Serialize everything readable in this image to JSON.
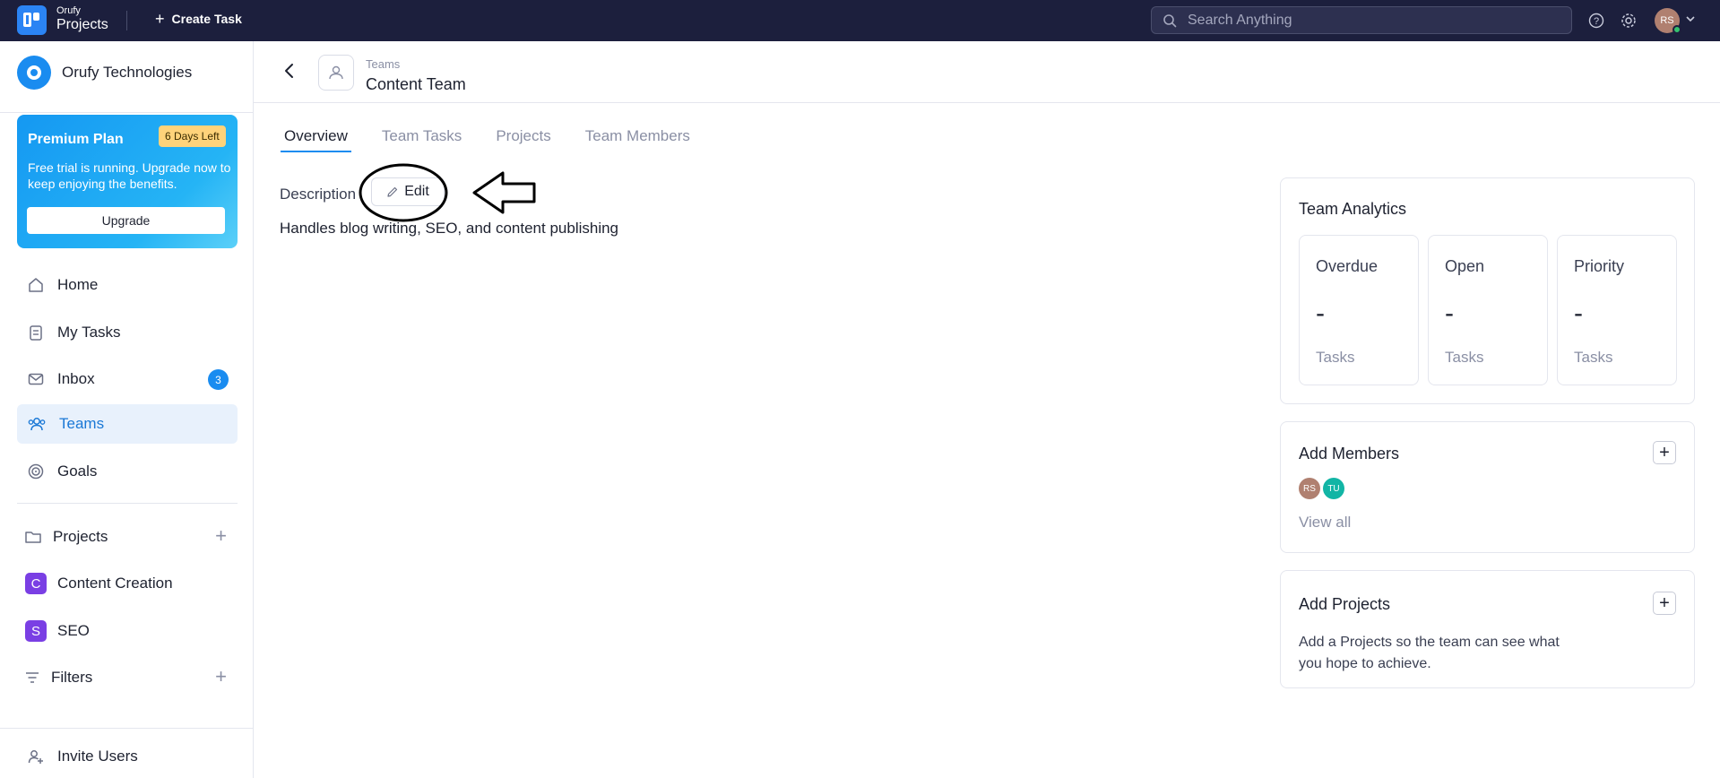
{
  "topbar": {
    "brand_small": "Orufy",
    "brand_big": "Projects",
    "create_task_label": "Create Task",
    "search_placeholder": "Search Anything",
    "user_initials": "RS"
  },
  "sidebar": {
    "org_name": "Orufy Technologies",
    "plan": {
      "title": "Premium Plan",
      "badge": "6 Days Left",
      "description": "Free trial is running. Upgrade now to keep enjoying the benefits.",
      "button": "Upgrade"
    },
    "nav": [
      {
        "label": "Home",
        "icon": "home-icon"
      },
      {
        "label": "My Tasks",
        "icon": "clipboard-icon"
      },
      {
        "label": "Inbox",
        "icon": "mail-icon",
        "badge": "3"
      },
      {
        "label": "Teams",
        "icon": "users-icon",
        "active": true
      },
      {
        "label": "Goals",
        "icon": "target-icon"
      }
    ],
    "projects_label": "Projects",
    "projects": [
      {
        "letter": "C",
        "label": "Content Creation"
      },
      {
        "letter": "S",
        "label": "SEO"
      }
    ],
    "filters_label": "Filters",
    "invite_label": "Invite Users"
  },
  "header": {
    "breadcrumb": "Teams",
    "title": "Content Team"
  },
  "tabs": [
    "Overview",
    "Team Tasks",
    "Projects",
    "Team Members"
  ],
  "overview": {
    "description_label": "Description",
    "edit_label": "Edit",
    "description_text": "Handles blog writing, SEO, and content publishing"
  },
  "analytics": {
    "title": "Team Analytics",
    "stats": [
      {
        "label": "Overdue",
        "value": "-",
        "unit": "Tasks"
      },
      {
        "label": "Open",
        "value": "-",
        "unit": "Tasks"
      },
      {
        "label": "Priority",
        "value": "-",
        "unit": "Tasks"
      }
    ]
  },
  "members": {
    "title": "Add Members",
    "avatars": [
      {
        "initials": "RS",
        "color": "#b08070"
      },
      {
        "initials": "TU",
        "color": "#12b5a5"
      }
    ],
    "view_all": "View all"
  },
  "projects_card": {
    "title": "Add Projects",
    "text": "Add a Projects so the team can see what you hope to achieve."
  },
  "colors": {
    "topbar": "#1c1f3d",
    "accent": "#1a8cf0",
    "project_badge": "#7a3fe4"
  }
}
